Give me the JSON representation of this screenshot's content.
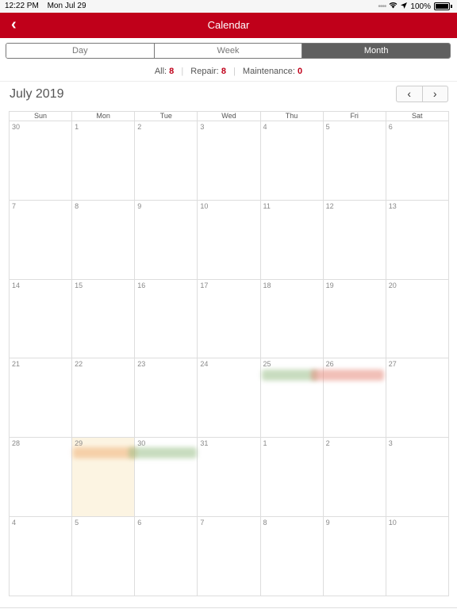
{
  "status_bar": {
    "time": "12:22 PM",
    "date": "Mon Jul 29",
    "battery": "100%"
  },
  "nav": {
    "title": "Calendar",
    "back_icon": "‹"
  },
  "segments": [
    {
      "label": "Day",
      "active": false
    },
    {
      "label": "Week",
      "active": false
    },
    {
      "label": "Month",
      "active": true
    }
  ],
  "counts": {
    "all_label": "All:",
    "all_value": "8",
    "repair_label": "Repair:",
    "repair_value": "8",
    "maintenance_label": "Maintenance:",
    "maintenance_value": "0"
  },
  "month_title": "July 2019",
  "pager": {
    "prev": "‹",
    "next": "›"
  },
  "weekdays": [
    "Sun",
    "Mon",
    "Tue",
    "Wed",
    "Thu",
    "Fri",
    "Sat"
  ],
  "weeks": [
    [
      "30",
      "1",
      "2",
      "3",
      "4",
      "5",
      "6"
    ],
    [
      "7",
      "8",
      "9",
      "10",
      "11",
      "12",
      "13"
    ],
    [
      "14",
      "15",
      "16",
      "17",
      "18",
      "19",
      "20"
    ],
    [
      "21",
      "22",
      "23",
      "24",
      "25",
      "26",
      "27"
    ],
    [
      "28",
      "29",
      "30",
      "31",
      "1",
      "2",
      "3"
    ],
    [
      "4",
      "5",
      "6",
      "7",
      "8",
      "9",
      "10"
    ]
  ],
  "today": {
    "week": 4,
    "day": 1
  },
  "colors": {
    "brand": "#c0001a",
    "event_green": "#9bc08a",
    "event_red": "#e58a7c",
    "event_orange": "#f0b27a"
  }
}
